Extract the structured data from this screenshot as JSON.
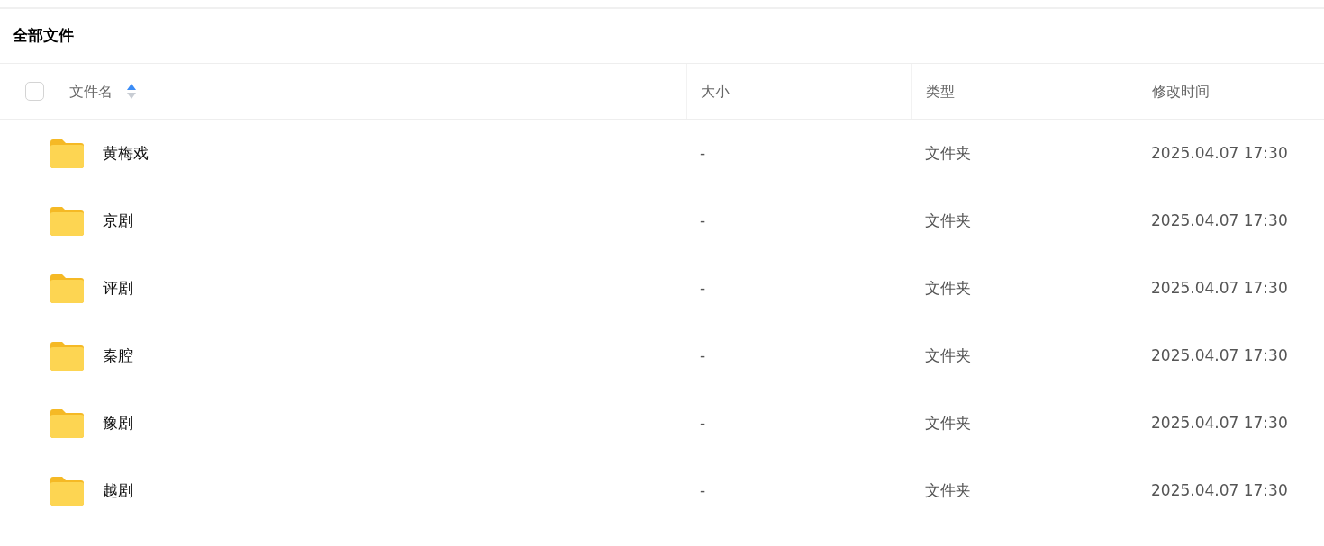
{
  "title": "全部文件",
  "table": {
    "select_all": {
      "checked": false
    },
    "columns": [
      {
        "label": "文件名",
        "sort_ascending": true
      },
      {
        "label": "大小"
      },
      {
        "label": "类型"
      },
      {
        "label": "修改时间"
      }
    ],
    "rows": [
      {
        "name": "黄梅戏",
        "size": "-",
        "type": "文件夹",
        "modified": "2025.04.07 17:30"
      },
      {
        "name": "京剧",
        "size": "-",
        "type": "文件夹",
        "modified": "2025.04.07 17:30"
      },
      {
        "name": "评剧",
        "size": "-",
        "type": "文件夹",
        "modified": "2025.04.07 17:30"
      },
      {
        "name": "秦腔",
        "size": "-",
        "type": "文件夹",
        "modified": "2025.04.07 17:30"
      },
      {
        "name": "豫剧",
        "size": "-",
        "type": "文件夹",
        "modified": "2025.04.07 17:30"
      },
      {
        "name": "越剧",
        "size": "-",
        "type": "文件夹",
        "modified": "2025.04.07 17:30"
      }
    ]
  }
}
